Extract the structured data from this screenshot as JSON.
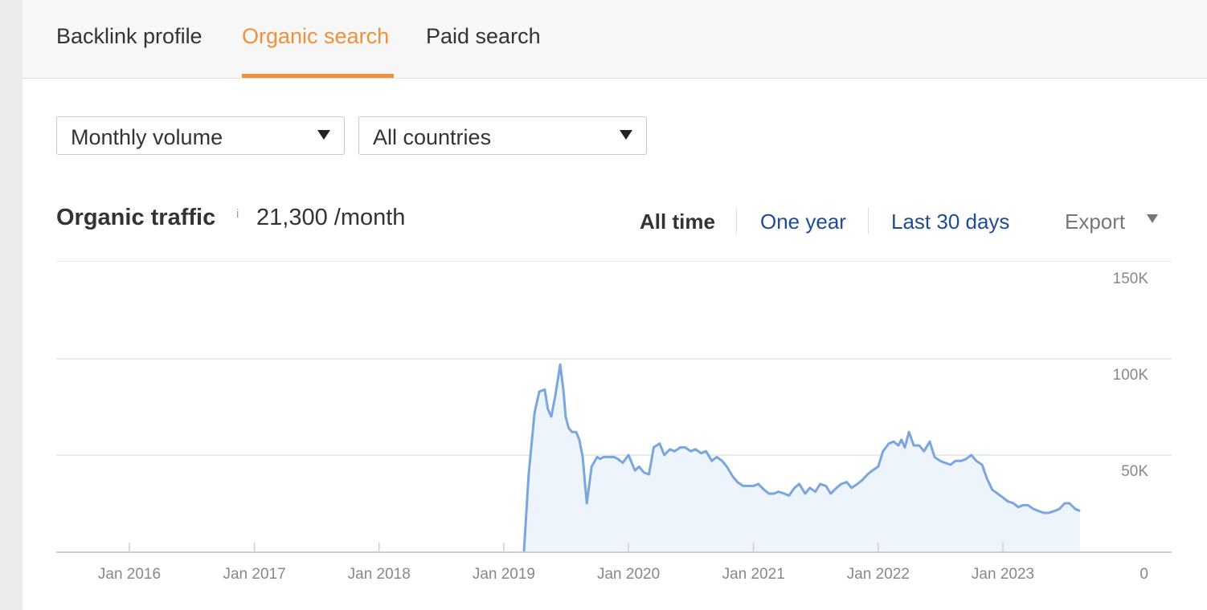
{
  "tabs": [
    {
      "label": "Backlink profile",
      "active": false
    },
    {
      "label": "Organic search",
      "active": true
    },
    {
      "label": "Paid search",
      "active": false
    }
  ],
  "filters": {
    "volume": {
      "selected": "Monthly volume"
    },
    "country": {
      "selected": "All countries"
    }
  },
  "header": {
    "title": "Organic traffic",
    "info_icon": "i",
    "metric_value": "21,300 /month"
  },
  "time_range": {
    "options": [
      "All time",
      "One year",
      "Last 30 days"
    ],
    "selected": "All time"
  },
  "export": {
    "label": "Export"
  },
  "colors": {
    "accent": "#f0903a",
    "link": "#1f4b97",
    "line": "#7aa6dd",
    "area": "#eef4fc"
  },
  "chart_data": {
    "type": "area",
    "title": "",
    "xlabel": "",
    "ylabel": "",
    "x_tick_labels": [
      "Jan 2016",
      "Jan 2017",
      "Jan 2018",
      "Jan 2019",
      "Jan 2020",
      "Jan 2021",
      "Jan 2022",
      "Jan 2023"
    ],
    "y_tick_labels": [
      "0",
      "50K",
      "100K",
      "150K"
    ],
    "ylim": [
      0,
      150000
    ],
    "xlim": [
      "2015-06-01",
      "2023-12-01"
    ],
    "grid": true,
    "series": [
      {
        "x": [
          "2019-03-01",
          "2019-03-15",
          "2019-04-01",
          "2019-04-15",
          "2019-05-01",
          "2019-05-10",
          "2019-05-20",
          "2019-06-01",
          "2019-06-15",
          "2019-06-25",
          "2019-07-01",
          "2019-07-10",
          "2019-07-20",
          "2019-08-01",
          "2019-08-10",
          "2019-08-20",
          "2019-09-01",
          "2019-09-15",
          "2019-10-01",
          "2019-10-10",
          "2019-10-20",
          "2019-11-01",
          "2019-11-10",
          "2019-11-20",
          "2019-12-01",
          "2019-12-15",
          "2020-01-01",
          "2020-01-20",
          "2020-02-01",
          "2020-02-15",
          "2020-03-01",
          "2020-03-15",
          "2020-04-01",
          "2020-04-15",
          "2020-05-01",
          "2020-05-15",
          "2020-06-01",
          "2020-06-15",
          "2020-07-01",
          "2020-07-15",
          "2020-08-01",
          "2020-08-15",
          "2020-09-01",
          "2020-09-15",
          "2020-10-01",
          "2020-10-15",
          "2020-11-01",
          "2020-11-15",
          "2020-12-01",
          "2021-01-01",
          "2021-01-15",
          "2021-02-01",
          "2021-02-15",
          "2021-03-01",
          "2021-03-15",
          "2021-04-01",
          "2021-04-15",
          "2021-05-01",
          "2021-05-15",
          "2021-06-01",
          "2021-06-15",
          "2021-07-01",
          "2021-07-15",
          "2021-08-01",
          "2021-08-15",
          "2021-09-01",
          "2021-09-15",
          "2021-10-01",
          "2021-10-15",
          "2021-11-01",
          "2021-11-15",
          "2021-12-01",
          "2021-12-15",
          "2022-01-01",
          "2022-01-15",
          "2022-02-01",
          "2022-02-15",
          "2022-03-01",
          "2022-03-10",
          "2022-03-20",
          "2022-04-01",
          "2022-04-15",
          "2022-05-01",
          "2022-05-15",
          "2022-06-01",
          "2022-06-15",
          "2022-07-01",
          "2022-07-15",
          "2022-08-01",
          "2022-08-15",
          "2022-09-01",
          "2022-09-15",
          "2022-10-01",
          "2022-10-15",
          "2022-11-01",
          "2022-11-15",
          "2022-12-01",
          "2023-01-01",
          "2023-01-15",
          "2023-02-01",
          "2023-02-15",
          "2023-03-01",
          "2023-03-15",
          "2023-04-01",
          "2023-04-15",
          "2023-05-01",
          "2023-05-15",
          "2023-06-01",
          "2023-06-15",
          "2023-07-01",
          "2023-07-15",
          "2023-08-01",
          "2023-08-15"
        ],
        "y": [
          0,
          40000,
          72000,
          83000,
          84000,
          74000,
          70000,
          81000,
          97000,
          83000,
          70000,
          64000,
          62000,
          62000,
          58000,
          49000,
          25000,
          44000,
          49000,
          48000,
          49000,
          49000,
          49000,
          49000,
          48000,
          46000,
          50000,
          42000,
          44000,
          41000,
          40000,
          54000,
          56000,
          50000,
          53000,
          52000,
          54000,
          54000,
          52000,
          53000,
          51000,
          52000,
          47000,
          49000,
          47000,
          44000,
          39000,
          36000,
          34000,
          34000,
          35000,
          32000,
          30000,
          30000,
          31000,
          30000,
          29000,
          33000,
          35000,
          30000,
          33000,
          31000,
          35000,
          34000,
          30000,
          33000,
          35000,
          36000,
          33000,
          35000,
          37000,
          40000,
          42000,
          44000,
          52000,
          56000,
          57000,
          55000,
          58000,
          54000,
          62000,
          55000,
          55000,
          52000,
          57000,
          49000,
          47000,
          46000,
          45000,
          47000,
          47000,
          48000,
          50000,
          47000,
          45000,
          38000,
          32000,
          28000,
          26000,
          25000,
          23000,
          24000,
          24000,
          22000,
          21000,
          20000,
          20000,
          21000,
          22000,
          25000,
          25000,
          22000,
          21000
        ]
      }
    ]
  }
}
